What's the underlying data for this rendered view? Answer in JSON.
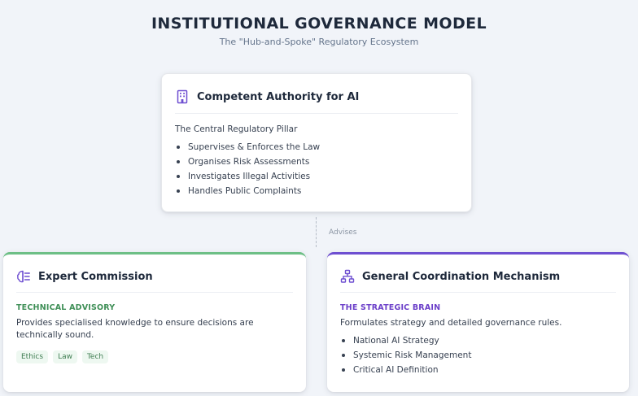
{
  "header": {
    "title": "INSTITUTIONAL GOVERNANCE MODEL",
    "subtitle": "The \"Hub-and-Spoke\" Regulatory Ecosystem"
  },
  "authority": {
    "icon": "building-icon",
    "title": "Competent Authority for AI",
    "subtitle": "The Central Regulatory Pillar",
    "items": [
      "Supervises & Enforces the Law",
      "Organises Risk Assessments",
      "Investigates Illegal Activities",
      "Handles Public Complaints"
    ]
  },
  "connector": {
    "label": "Advises"
  },
  "expert": {
    "icon": "brain-icon",
    "accent": "#6dbf86",
    "title": "Expert Commission",
    "tag": "TECHNICAL ADVISORY",
    "description": "Provides specialised knowledge to ensure decisions are technically sound.",
    "chips": [
      "Ethics",
      "Law",
      "Tech"
    ]
  },
  "coordination": {
    "icon": "network-icon",
    "accent": "#6e4fd1",
    "title": "General Coordination Mechanism",
    "tag": "THE STRATEGIC BRAIN",
    "description": "Formulates strategy and detailed governance rules.",
    "items": [
      "National AI Strategy",
      "Systemic Risk Management",
      "Critical AI Definition"
    ]
  }
}
